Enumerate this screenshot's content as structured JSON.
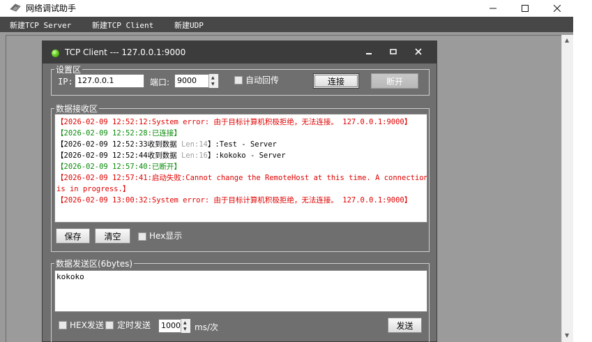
{
  "window": {
    "title": "网络调试助手",
    "buttons": [
      "minimize",
      "maximize",
      "close"
    ]
  },
  "menu": {
    "items": [
      "新建TCP Server",
      "新建TCP Client",
      "新建UDP"
    ]
  },
  "child": {
    "title": "TCP Client --- 127.0.0.1:9000",
    "settings": {
      "legend": "设置区",
      "ip_label": "IP:",
      "ip_value": "127.0.0.1",
      "port_label": "端口:",
      "port_value": "9000",
      "auto_echo_label": "自动回传",
      "connect_label": "连接",
      "disconnect_label": "断开"
    },
    "receive": {
      "legend": "数据接收区",
      "lines": [
        {
          "color": "red",
          "parts": [
            {
              "text": "【2026-02-09 12:52:12:System error: 由于目标计算机积极拒绝，无法连接。 127.0.0.1:9000】",
              "color": "red"
            }
          ]
        },
        {
          "color": "green",
          "parts": [
            {
              "text": "【2026-02-09 12:52:28:已连接】",
              "color": "green"
            }
          ]
        },
        {
          "color": "black",
          "parts": [
            {
              "text": "【2026-02-09 12:52:33收到数据 ",
              "color": "black"
            },
            {
              "text": "Len:14",
              "color": "gray"
            },
            {
              "text": "】:Test  - Server",
              "color": "black"
            }
          ]
        },
        {
          "color": "black",
          "parts": [
            {
              "text": "【2026-02-09 12:52:44收到数据 ",
              "color": "black"
            },
            {
              "text": "Len:16",
              "color": "gray"
            },
            {
              "text": "】:kokoko  - Server",
              "color": "black"
            }
          ]
        },
        {
          "color": "green",
          "parts": [
            {
              "text": "【2026-02-09 12:57:40:已断开】",
              "color": "green"
            }
          ]
        },
        {
          "color": "red",
          "parts": [
            {
              "text": "【2026-02-09 12:57:41:启动失败:Cannot change the RemoteHost at this time. A connection",
              "color": "red"
            }
          ]
        },
        {
          "color": "red",
          "parts": [
            {
              "text": "is in progress.】",
              "color": "red"
            }
          ]
        },
        {
          "color": "red",
          "parts": [
            {
              "text": "【2026-02-09 13:00:32:System error: 由于目标计算机积极拒绝，无法连接。 127.0.0.1:9000】",
              "color": "red"
            }
          ]
        }
      ],
      "save_label": "保存",
      "clear_label": "清空",
      "hex_display_label": "Hex显示"
    },
    "send": {
      "legend": "数据发送区(6bytes)",
      "content": "kokoko",
      "hex_send_label": "HEX发送",
      "timed_send_label": "定时发送",
      "interval_value": "1000",
      "interval_unit": "ms/次",
      "send_label": "发送"
    }
  },
  "colors": {
    "menubar": "#474747",
    "child_background": "#6f6f6f",
    "child_titlebar": "#3c3c3c",
    "error_red": "#e00000",
    "status_green": "#0a8a0a"
  }
}
